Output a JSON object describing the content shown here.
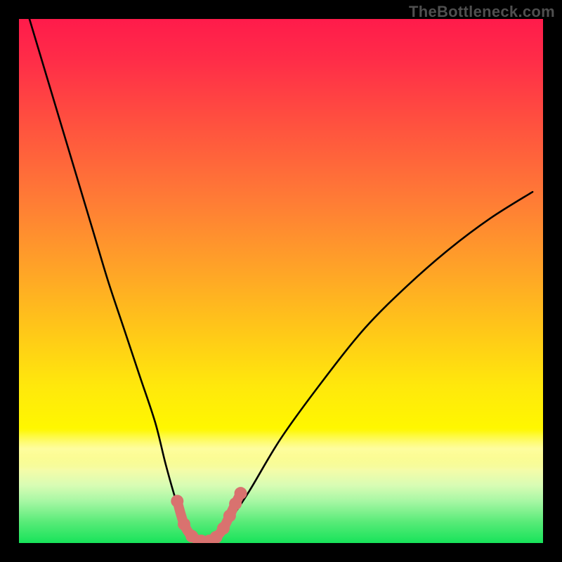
{
  "watermark": "TheBottleneck.com",
  "chart_data": {
    "type": "line",
    "title": "",
    "xlabel": "",
    "ylabel": "",
    "xlim": [
      0,
      100
    ],
    "ylim": [
      0,
      100
    ],
    "grid": false,
    "legend": false,
    "series": [
      {
        "name": "bottleneck-curve",
        "x": [
          2,
          5,
          8,
          11,
          14,
          17,
          20,
          23,
          26,
          28,
          30,
          31.5,
          33,
          34.5,
          36,
          38,
          40,
          44,
          50,
          58,
          66,
          74,
          82,
          90,
          98
        ],
        "values": [
          100,
          90,
          80,
          70,
          60,
          50,
          41,
          32,
          23,
          15,
          8,
          4,
          1.5,
          0.5,
          0.5,
          1.5,
          4,
          10,
          20,
          31,
          41,
          49,
          56,
          62,
          67
        ]
      }
    ],
    "markers": {
      "name": "trough-points",
      "color": "#d9726f",
      "x": [
        30.2,
        31.5,
        33.0,
        34.8,
        36.3,
        37.6,
        39.0,
        40.2,
        41.3,
        42.3
      ],
      "values": [
        8.0,
        3.6,
        1.3,
        0.4,
        0.4,
        1.1,
        2.8,
        5.2,
        7.5,
        9.5
      ]
    },
    "gradient_stops": [
      {
        "pos": 0,
        "color": "#ff1b4b"
      },
      {
        "pos": 20,
        "color": "#ff513f"
      },
      {
        "pos": 48,
        "color": "#ffa427"
      },
      {
        "pos": 70,
        "color": "#ffe80c"
      },
      {
        "pos": 86,
        "color": "#f5fca8"
      },
      {
        "pos": 100,
        "color": "#17e35a"
      }
    ]
  }
}
